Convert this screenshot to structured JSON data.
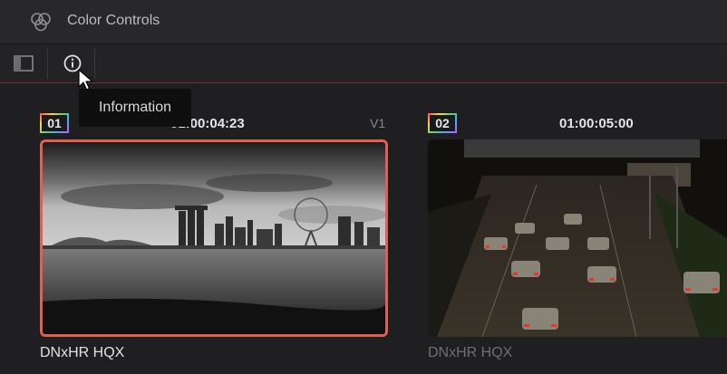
{
  "app": {
    "title": "Color Controls"
  },
  "toolbar": {
    "buttons": [
      {
        "icon": "sidebar-toggle-icon"
      },
      {
        "icon": "info-icon"
      }
    ],
    "tooltip": "Information"
  },
  "clips": [
    {
      "number": "01",
      "timecode": "01:00:04:23",
      "track": "V1",
      "codec": "DNxHR HQX",
      "selected": true
    },
    {
      "number": "02",
      "timecode": "01:00:05:00",
      "track": "",
      "codec": "DNxHR HQX",
      "selected": false
    }
  ],
  "colors": {
    "accent": "#e0614f",
    "background": "#1f1f21"
  }
}
